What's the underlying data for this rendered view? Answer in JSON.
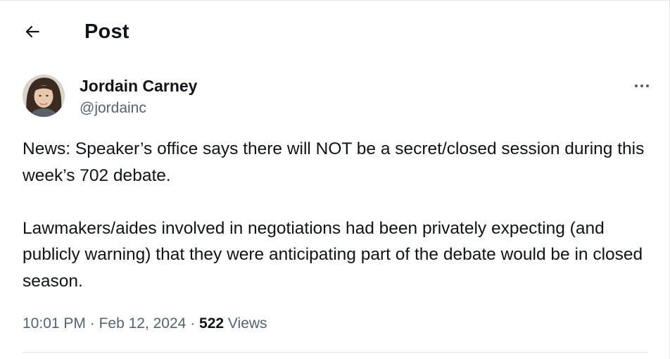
{
  "header": {
    "back_icon": "arrow-left-icon",
    "title": "Post"
  },
  "author": {
    "name": "Jordain Carney",
    "handle": "@jordainc",
    "avatar_icon": "user-avatar"
  },
  "more_icon": "more-horizontal-icon",
  "tweet": {
    "paragraphs": [
      "News: Speaker’s office says there will NOT be a secret/closed session during this week’s 702 debate.",
      "Lawmakers/aides involved in negotiations had been privately expecting (and publicly warning) that they were anticipating part of the debate would be in closed season."
    ]
  },
  "meta": {
    "time": "10:01 PM",
    "separator": "·",
    "date": "Feb 12, 2024",
    "views_count": "522",
    "views_label": "Views"
  },
  "colors": {
    "text_primary": "#0f1419",
    "text_secondary": "#536471",
    "divider": "#e6e8eb"
  }
}
